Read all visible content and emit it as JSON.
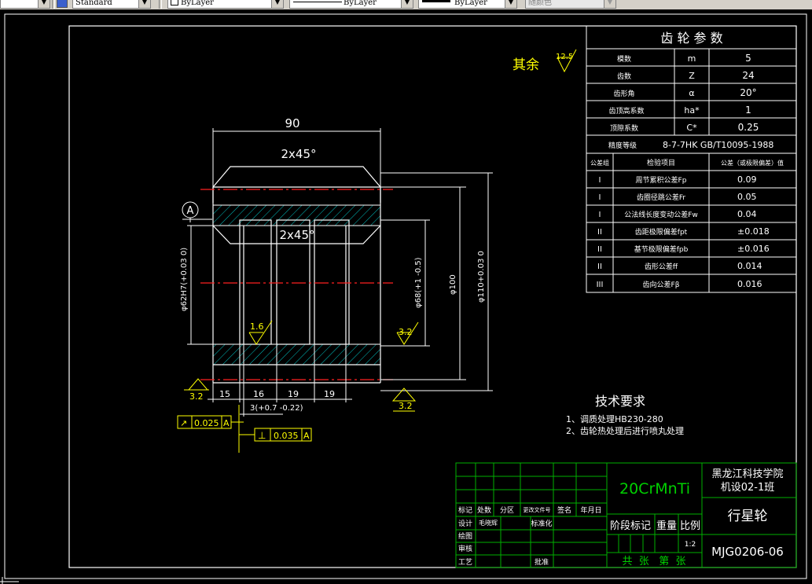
{
  "toolbar": {
    "textstyle": "Standard",
    "layer": "ByLayer",
    "linetype": "ByLayer",
    "lineweight": "ByLayer",
    "color": "随颜色"
  },
  "drawing": {
    "dims": {
      "length": "90",
      "chamfer_top": "2x45°",
      "chamfer_inner": "2x45°",
      "bore": "φ62H7(+0.03 0)",
      "groove": "φ68(+1 -0.5)",
      "dia100": "φ100",
      "outer": "φ110+0.03 0",
      "seg_15": "15",
      "seg_16": "16",
      "seg_19a": "19",
      "seg_19b": "19",
      "three": "3(+0.7 -0.22)"
    },
    "datum": "A",
    "roughness_rest_label": "其余",
    "roughness_rest": "12.5",
    "roughness_1_6": "1.6",
    "roughness_3_2_right": "3.2",
    "roughness_3_2_bl": "3.2",
    "roughness_3_2_bm": "3.2",
    "tol_runout_sym": "↗",
    "tol_runout_val": "0.025",
    "tol_runout_ref": "A",
    "tol_perp_sym": "⊥",
    "tol_perp_val": "0.035",
    "tol_perp_ref": "A"
  },
  "gear_params": {
    "title": "齿 轮 参 数",
    "rows": [
      {
        "label": "模数",
        "sym": "m",
        "val": "5"
      },
      {
        "label": "齿数",
        "sym": "Z",
        "val": "24"
      },
      {
        "label": "齿形角",
        "sym": "α",
        "val": "20°"
      },
      {
        "label": "齿顶高系数",
        "sym": "ha*",
        "val": "1"
      },
      {
        "label": "顶隙系数",
        "sym": "C*",
        "val": "0.25"
      }
    ],
    "precision_label": "精度等级",
    "precision_val": "8-7-7HK  GB/T10095-1988",
    "hdr_group": "公差组",
    "hdr_item": "检验项目",
    "hdr_tol": "公差（或极限偏差）值",
    "checks": [
      {
        "group": "I",
        "item": "周节累积公差Fp",
        "val": "0.09"
      },
      {
        "group": "I",
        "item": "齿圈径跳公差Fr",
        "val": "0.05"
      },
      {
        "group": "I",
        "item": "公法线长度变动公差Fw",
        "val": "0.04"
      },
      {
        "group": "II",
        "item": "齿距极限偏差fpt",
        "val": "±0.018"
      },
      {
        "group": "II",
        "item": "基节极限偏差fpb",
        "val": "±0.016"
      },
      {
        "group": "II",
        "item": "齿形公差ff",
        "val": "0.014"
      },
      {
        "group": "III",
        "item": "齿向公差Fβ",
        "val": "0.016"
      }
    ]
  },
  "tech_req": {
    "title": "技术要求",
    "line1": "1、调质处理HB230-280",
    "line2": "2、齿轮热处理后进行喷丸处理"
  },
  "title_block": {
    "material": "20CrMnTi",
    "school": "黑龙江科技学院",
    "class": "机设02-1班",
    "part_name": "行星轮",
    "code": "MJG0206-06",
    "stage": "阶段标记",
    "weight": "重量",
    "scale_label": "比例",
    "scale": "1:2",
    "sheets": "共  张   第  张",
    "r_mark": "标记",
    "r_count": "处数",
    "r_zone": "分区",
    "r_docno": "更改文件号",
    "r_sign": "签名",
    "r_date": "年月日",
    "r_design": "设计",
    "r_std_sign": "毛晓辉",
    "r_std": "标准化",
    "r_draw": "绘图",
    "r_check": "审核",
    "r_process": "工艺",
    "r_approve": "批准"
  }
}
